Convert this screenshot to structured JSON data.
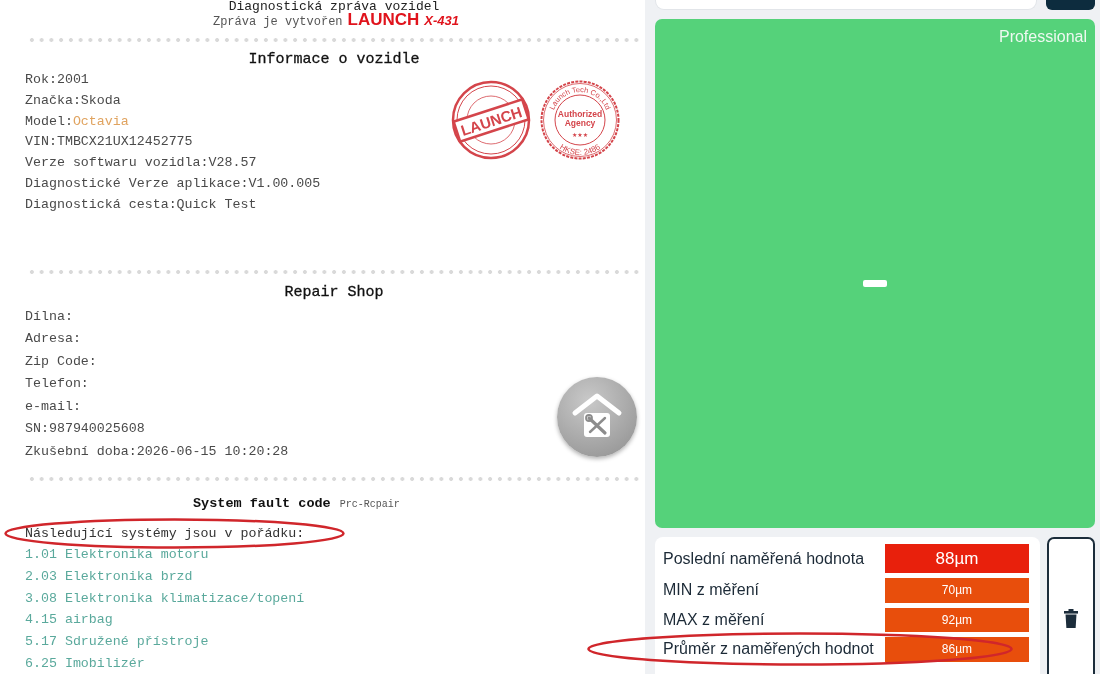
{
  "report": {
    "title": "Diagnostická zpráva vozidel",
    "subtitle": "Zpráva je vytvořen",
    "logo": {
      "brand": "LAUNCH",
      "model": "X-431"
    },
    "vehicle_info": {
      "heading": "Informace o vozidle",
      "rows": [
        {
          "label": "Rok:",
          "value": "2001",
          "highlighted": false
        },
        {
          "label": "Značka:",
          "value": "Skoda",
          "highlighted": false
        },
        {
          "label": "Model:",
          "value": "Octavia",
          "highlighted": true
        },
        {
          "label": "VIN:",
          "value": "TMBCX21UX12452775",
          "highlighted": false
        },
        {
          "label": "Verze softwaru vozidla:",
          "value": "V28.57",
          "highlighted": false
        },
        {
          "label": "Diagnostické Verze aplikace:",
          "value": "V1.00.005",
          "highlighted": false
        },
        {
          "label": "Diagnostická cesta:",
          "value": "Quick Test",
          "highlighted": false
        }
      ],
      "stamps": [
        {
          "kind": "banner",
          "text": "LAUNCH"
        },
        {
          "kind": "seal",
          "top_text": "Launch Tech Co.,Ltd",
          "lines": [
            "Authorized",
            "Agency"
          ],
          "mark": "★★★",
          "bottom_text": "HKSE: 2486"
        }
      ]
    },
    "repair_shop": {
      "heading": "Repair Shop",
      "rows": [
        {
          "label": "Dílna:"
        },
        {
          "label": "Adresa:"
        },
        {
          "label": "Zip Code:"
        },
        {
          "label": "Telefon:"
        },
        {
          "label": "e-mail:"
        },
        {
          "label": "SN:",
          "value": "987940025608"
        },
        {
          "label": "Zkušební doba:",
          "value": "2026-06-15 10:20:28"
        }
      ]
    },
    "fault_codes": {
      "heading": "System fault code",
      "tag": "Prc-Rcpair",
      "intro": {
        "text": "Následující systémy jsou v pořádku:",
        "circled": true
      },
      "systems": [
        "1.01 Elektronika motoru",
        "2.03 Elektronika brzd",
        "3.08 Elektronika klimatizace/topení",
        "4.15 airbag",
        "5.17 Sdružené přístroje",
        "6.25 Imobilizér"
      ]
    }
  },
  "side_panel": {
    "status_label": "Professional",
    "measurements": [
      {
        "label": "Poslední naměřená hodnota",
        "value": "88µm",
        "kind": "latest",
        "color": "#e8200c",
        "circled": false
      },
      {
        "label": "MIN z měření",
        "value": "70µm",
        "kind": "stat",
        "color": "#e84e0c",
        "circled": false
      },
      {
        "label": "MAX z měření",
        "value": "92µm",
        "kind": "stat",
        "color": "#e84e0c",
        "circled": false
      },
      {
        "label": "Průměr z naměřených hodnot",
        "value": "86µm",
        "kind": "stat",
        "color": "#e84e0c",
        "circled": true
      }
    ]
  }
}
